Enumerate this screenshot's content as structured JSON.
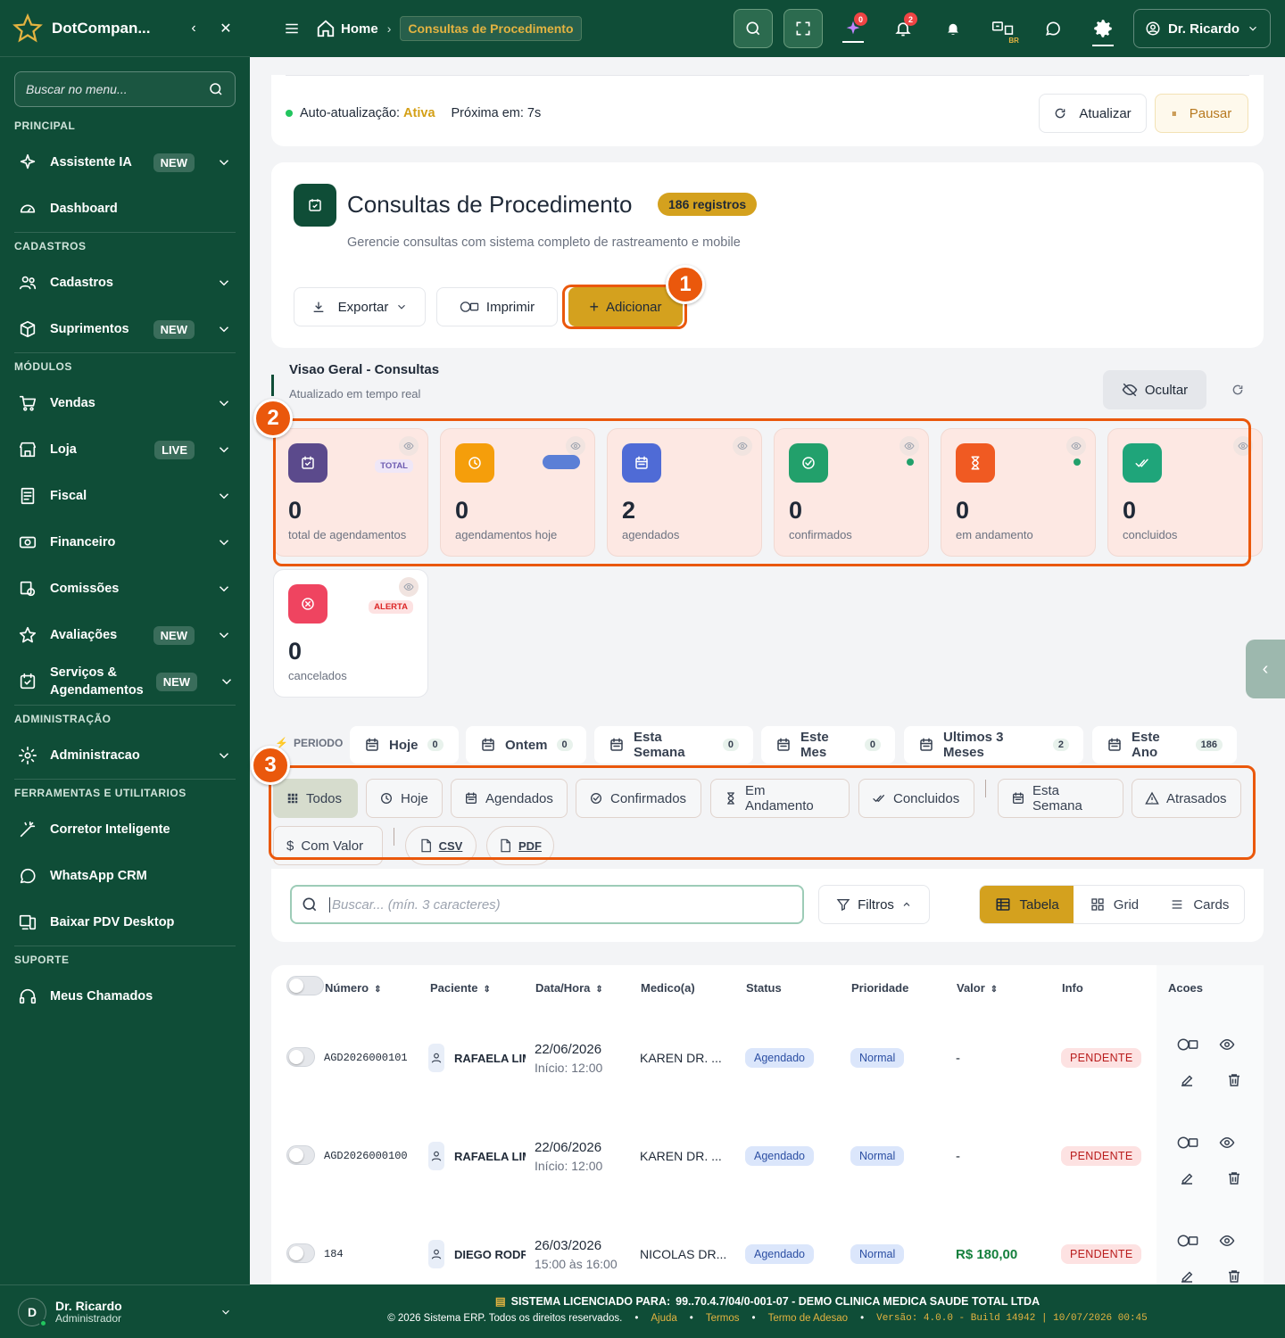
{
  "sidebar": {
    "brand": "DotCompan...",
    "search_placeholder": "Buscar no menu...",
    "sections": [
      {
        "title": "PRINCIPAL",
        "items": [
          {
            "label": "Assistente IA",
            "badge": "NEW",
            "icon": "sparkle-icon",
            "chevron": true
          },
          {
            "label": "Dashboard",
            "icon": "dashboard-icon",
            "chevron": false
          }
        ]
      },
      {
        "title": "CADASTROS",
        "items": [
          {
            "label": "Cadastros",
            "icon": "users-icon",
            "chevron": true
          },
          {
            "label": "Suprimentos",
            "badge": "NEW",
            "icon": "box-icon",
            "chevron": true
          }
        ]
      },
      {
        "title": "MÓDULOS",
        "items": [
          {
            "label": "Vendas",
            "icon": "cart-icon",
            "chevron": true
          },
          {
            "label": "Loja",
            "badge": "LIVE",
            "icon": "store-icon",
            "chevron": true
          },
          {
            "label": "Fiscal",
            "icon": "receipt-icon",
            "chevron": true
          },
          {
            "label": "Financeiro",
            "icon": "money-icon",
            "chevron": true
          },
          {
            "label": "Comissões",
            "icon": "commission-icon",
            "chevron": true
          },
          {
            "label": "Avaliações",
            "badge": "NEW",
            "icon": "star-icon",
            "chevron": true
          },
          {
            "label": "Serviços & Agendamentos",
            "badge": "NEW",
            "icon": "calendar-check-icon",
            "chevron": true
          }
        ]
      },
      {
        "title": "ADMINISTRAÇÃO",
        "items": [
          {
            "label": "Administracao",
            "icon": "gear-icon",
            "chevron": true
          }
        ]
      },
      {
        "title": "FERRAMENTAS E UTILITARIOS",
        "items": [
          {
            "label": "Corretor Inteligente",
            "icon": "wand-icon",
            "chevron": false
          },
          {
            "label": "WhatsApp CRM",
            "icon": "whatsapp-icon",
            "chevron": false
          },
          {
            "label": "Baixar PDV Desktop",
            "icon": "desktop-icon",
            "chevron": false
          }
        ]
      },
      {
        "title": "SUPORTE",
        "items": [
          {
            "label": "Meus Chamados",
            "icon": "headset-icon",
            "chevron": false
          }
        ]
      }
    ],
    "user": {
      "initial": "D",
      "name": "Dr. Ricardo",
      "role": "Administrador"
    }
  },
  "topbar": {
    "home": "Home",
    "current": "Consultas de Procedimento",
    "notif_ai": "0",
    "notif_bell": "2",
    "lang": "BR",
    "user": "Dr. Ricardo"
  },
  "autorefresh": {
    "label": "Auto-atualização:",
    "status": "Ativa",
    "next": "Próxima em: 7s",
    "refresh_btn": "Atualizar",
    "pause_btn": "Pausar"
  },
  "header": {
    "title": "Consultas de Procedimento",
    "count": "186 registros",
    "subtitle": "Gerencie consultas com sistema completo de rastreamento e mobile",
    "export": "Exportar",
    "print": "Imprimir",
    "add": "Adicionar"
  },
  "annotations": [
    "1",
    "2",
    "3"
  ],
  "overview": {
    "title": "Visao Geral - Consultas",
    "subtitle": "Atualizado em tempo real",
    "hide": "Ocultar"
  },
  "stats": [
    {
      "value": "0",
      "label": "total de agendamentos",
      "tag": "TOTAL",
      "color": "#5b4a8c",
      "icon": "calendar-check-icon"
    },
    {
      "value": "0",
      "label": "agendamentos hoje",
      "color": "#f59e0b",
      "icon": "clock-icon"
    },
    {
      "value": "2",
      "label": "agendados",
      "color": "#4f6bd6",
      "icon": "calendar-icon"
    },
    {
      "value": "0",
      "label": "confirmados",
      "color": "#22a06b",
      "icon": "check-circle-icon"
    },
    {
      "value": "0",
      "label": "em andamento",
      "color": "#f05a22",
      "icon": "hourglass-icon"
    },
    {
      "value": "0",
      "label": "concluidos",
      "color": "#1fa57a",
      "icon": "double-check-icon"
    },
    {
      "value": "0",
      "label": "cancelados",
      "tag": "ALERTA",
      "color": "#ef4460",
      "icon": "x-circle-icon"
    }
  ],
  "period": {
    "label": "PERIODO",
    "tabs": [
      {
        "label": "Hoje",
        "count": "0"
      },
      {
        "label": "Ontem",
        "count": "0"
      },
      {
        "label": "Esta Semana",
        "count": "0"
      },
      {
        "label": "Este Mes",
        "count": "0"
      },
      {
        "label": "Ultimos 3 Meses",
        "count": "2"
      },
      {
        "label": "Este Ano",
        "count": "186"
      }
    ]
  },
  "filters": {
    "chips": [
      "Todos",
      "Hoje",
      "Agendados",
      "Confirmados",
      "Em Andamento",
      "Concluidos",
      "Esta Semana",
      "Atrasados",
      "Com Valor"
    ],
    "csv": "CSV",
    "pdf": "PDF"
  },
  "search": {
    "placeholder": "Buscar... (mín. 3 caracteres)",
    "filters": "Filtros",
    "views": [
      "Tabela",
      "Grid",
      "Cards"
    ]
  },
  "table": {
    "headers": [
      "Número",
      "Paciente",
      "Data/Hora",
      "Medico(a)",
      "Status",
      "Prioridade",
      "Valor",
      "Info",
      "Acoes"
    ],
    "rows": [
      {
        "numero": "AGD2026000101",
        "paciente": "RAFAELA LIM",
        "data": "22/06/2026",
        "inicio": "Início: 12:00",
        "medico": "KAREN DR. ...",
        "status": "Agendado",
        "prioridade": "Normal",
        "valor": "-",
        "info": "PENDENTE"
      },
      {
        "numero": "AGD2026000100",
        "paciente": "RAFAELA LIM",
        "data": "22/06/2026",
        "inicio": "Início: 12:00",
        "medico": "KAREN DR. ...",
        "status": "Agendado",
        "prioridade": "Normal",
        "valor": "-",
        "info": "PENDENTE"
      },
      {
        "numero": "184",
        "paciente": "DIEGO RODR",
        "data": "26/03/2026",
        "inicio": "15:00 às 16:00",
        "medico": "NICOLAS DR...",
        "status": "Agendado",
        "prioridade": "Normal",
        "valor": "R$ 180,00",
        "info": "PENDENTE"
      }
    ]
  },
  "footer": {
    "license_label": "SISTEMA LICENCIADO PARA:",
    "license_value": "99..70.4.7/04/0-001-07 - DEMO CLINICA MEDICA SAUDE TOTAL LTDA",
    "copyright": "© 2026 Sistema ERP. Todos os direitos reservados.",
    "links": [
      "Ajuda",
      "Termos",
      "Termo de Adesao"
    ],
    "version": "Versão: 4.0.0 - Build 14942 | 10/07/2026 00:45"
  }
}
